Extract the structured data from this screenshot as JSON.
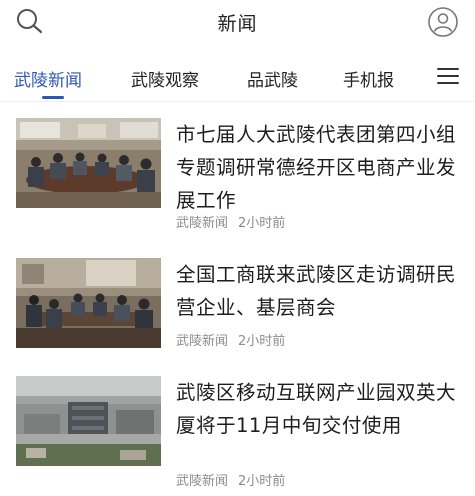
{
  "header": {
    "title": "新闻",
    "search_icon": "search-icon",
    "user_icon": "user-icon"
  },
  "tabs": [
    {
      "label": "武陵新闻",
      "active": true
    },
    {
      "label": "武陵观察",
      "active": false
    },
    {
      "label": "品武陵",
      "active": false
    },
    {
      "label": "手机报",
      "active": false
    }
  ],
  "menu_icon": "hamburger-menu-icon",
  "accent_color": "#2f57b7",
  "news": [
    {
      "headline": "市七届人大武陵代表团第四小组专题调研常德经开区电商产业发展工作",
      "source": "武陵新闻",
      "time": "2小时前",
      "image": "meeting-room-photo"
    },
    {
      "headline": "全国工商联来武陵区走访调研民营企业、基层商会",
      "source": "武陵新闻",
      "time": "2小时前",
      "image": "conference-table-photo"
    },
    {
      "headline": "武陵区移动互联网产业园双英大厦将于11月中旬交付使用",
      "source": "武陵新闻",
      "time": "2小时前",
      "image": "aerial-city-photo"
    }
  ]
}
